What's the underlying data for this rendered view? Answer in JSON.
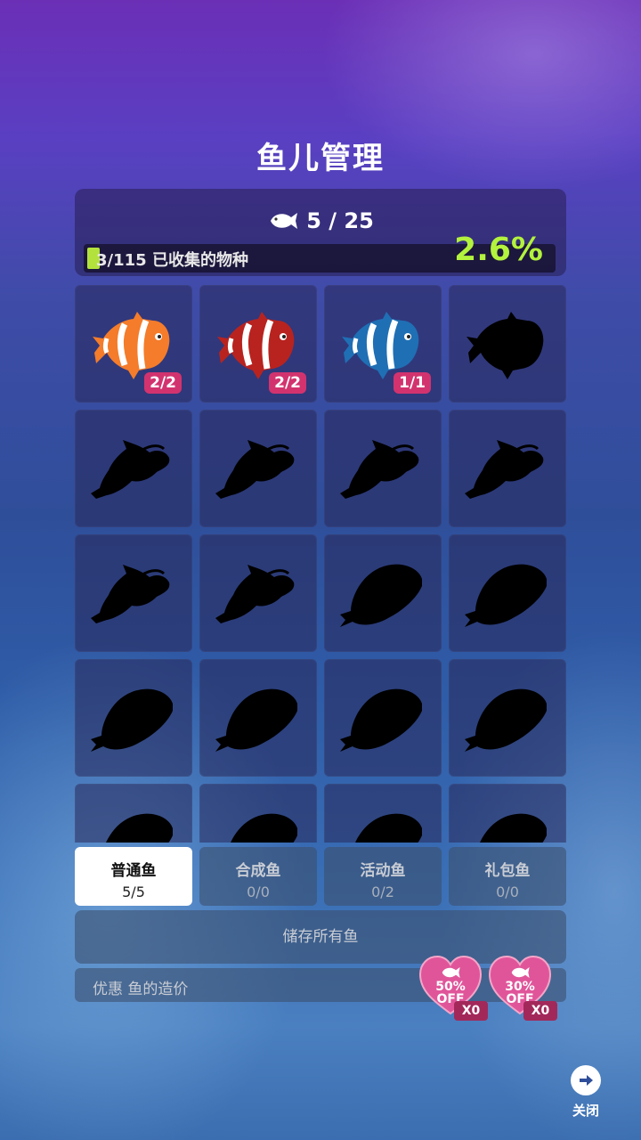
{
  "title": "鱼儿管理",
  "capacity": {
    "current": "5",
    "max": "25",
    "text": "5 / 25",
    "icon": "fish-icon"
  },
  "collection": {
    "text": "3/115 已收集的物种",
    "percent_text": "2.6%",
    "progress_fraction": 0.026,
    "accent": "#b3f23d"
  },
  "fish_grid": [
    {
      "kind": "clownfish",
      "color": "#f47c2a",
      "stripe": "#ffffff",
      "badge": "2/2",
      "unlocked": true
    },
    {
      "kind": "clownfish",
      "color": "#b8231f",
      "stripe": "#ffffff",
      "badge": "2/2",
      "unlocked": true
    },
    {
      "kind": "clownfish",
      "color": "#1f6fb5",
      "stripe": "#ffffff",
      "badge": "1/1",
      "unlocked": true
    },
    {
      "kind": "clownfish",
      "unlocked": false
    },
    {
      "kind": "catfish",
      "unlocked": false
    },
    {
      "kind": "catfish",
      "unlocked": false
    },
    {
      "kind": "catfish",
      "unlocked": false
    },
    {
      "kind": "catfish",
      "unlocked": false
    },
    {
      "kind": "catfish",
      "unlocked": false
    },
    {
      "kind": "catfish",
      "unlocked": false
    },
    {
      "kind": "flatfish",
      "unlocked": false
    },
    {
      "kind": "flatfish",
      "unlocked": false
    },
    {
      "kind": "flatfish",
      "unlocked": false
    },
    {
      "kind": "flatfish",
      "unlocked": false
    },
    {
      "kind": "flatfish",
      "unlocked": false
    },
    {
      "kind": "flatfish",
      "unlocked": false
    },
    {
      "kind": "flatfish",
      "unlocked": false
    },
    {
      "kind": "flatfish",
      "unlocked": false
    },
    {
      "kind": "flatfish",
      "unlocked": false
    },
    {
      "kind": "flatfish",
      "unlocked": false
    }
  ],
  "tabs": [
    {
      "label": "普通鱼",
      "count": "5/5",
      "active": true
    },
    {
      "label": "合成鱼",
      "count": "0/0",
      "active": false
    },
    {
      "label": "活动鱼",
      "count": "0/2",
      "active": false
    },
    {
      "label": "礼包鱼",
      "count": "0/0",
      "active": false
    }
  ],
  "store_all_label": "储存所有鱼",
  "discount": {
    "label": "优惠 鱼的造价",
    "coupons": [
      {
        "percent": "50%",
        "off": "OFF",
        "qty": "X0"
      },
      {
        "percent": "30%",
        "off": "OFF",
        "qty": "X0"
      }
    ],
    "coupon_color": "#e0559a"
  },
  "close_label": "关闭"
}
